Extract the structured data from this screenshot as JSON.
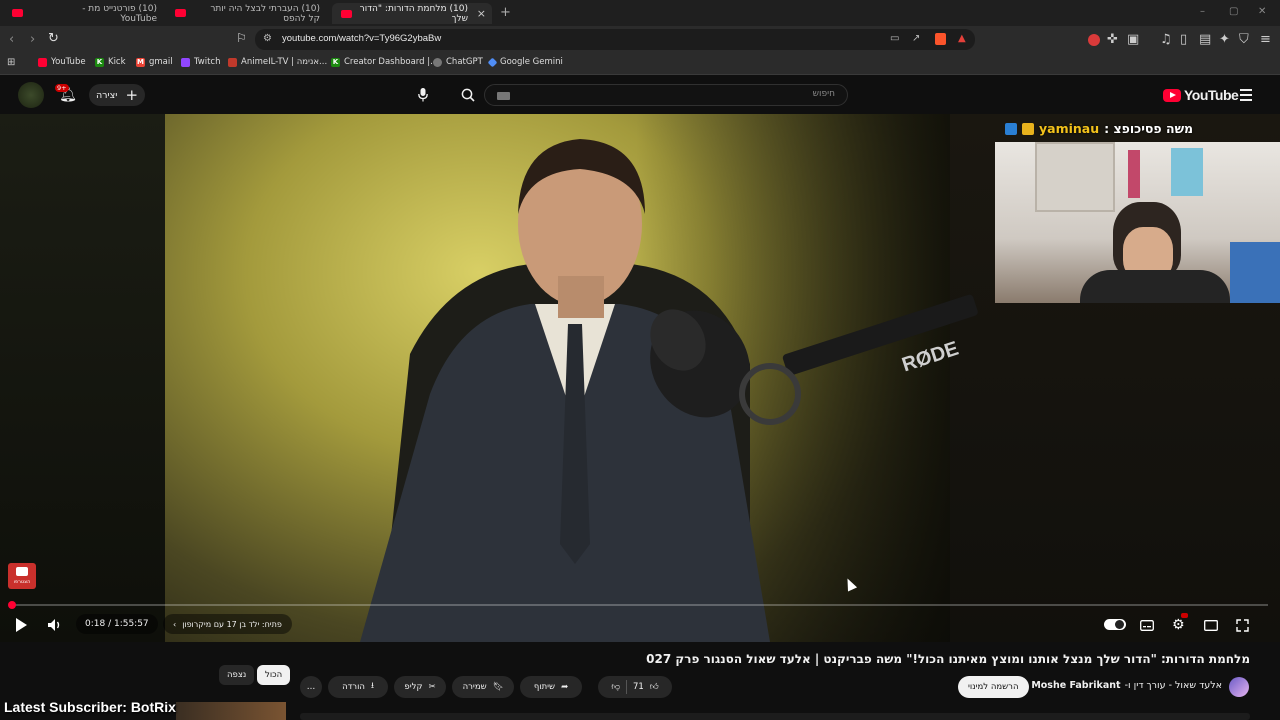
{
  "browser": {
    "tabs": [
      {
        "label": "(10) פורטנייט מת - YouTube",
        "active": false
      },
      {
        "label": "(10) העברתי לבצל היה יותר קל להפס",
        "active": false
      },
      {
        "label": "(10) מלחמת הדורות: \"הדור שלך",
        "active": true
      }
    ],
    "url": "youtube.com/watch?v=Ty96G2ybaBw",
    "bookmarks": [
      {
        "label": "YouTube",
        "icon": "youtube-icon",
        "color": "#ff0033"
      },
      {
        "label": "Kick",
        "icon": "kick-icon",
        "color": "#53fc18"
      },
      {
        "label": "gmail",
        "icon": "gmail-icon",
        "color": "#ea4335"
      },
      {
        "label": "Twitch",
        "icon": "twitch-icon",
        "color": "#9146ff"
      },
      {
        "label": "AnimeIL-TV | אנימה...",
        "icon": "animeil-icon",
        "color": "#c0392b"
      },
      {
        "label": "Creator Dashboard |...",
        "icon": "kick-icon",
        "color": "#53fc18"
      },
      {
        "label": "ChatGPT",
        "icon": "chatgpt-icon",
        "color": "#777777"
      },
      {
        "label": "Google Gemini",
        "icon": "gemini-icon",
        "color": "#4f8df5"
      }
    ]
  },
  "youtube": {
    "search_placeholder": "חיפוש",
    "create_label": "יצירה",
    "notifications_count": "9+",
    "logo_text": "YouTube",
    "accent": "#ff0033"
  },
  "player": {
    "overlay_prefix": "משה פסיכופצ :",
    "overlay_name": "yaminau",
    "time": "0:18 / 1:55:57",
    "chapter": "פתיח: ילד בן 17 עם מיקרופון",
    "progress_fraction": 0.0026,
    "subscribe_badge": "הצטרפו",
    "mic_brand": "RØDE"
  },
  "video": {
    "title": "מלחמת הדורות: \"הדור שלך מנצל אותנו ומוצץ מאיתנו הכול!\" משה פבריקנט | אלעד שאול הסנגור פרק 027",
    "channel_prefix": "אלעד שאול - עורך דין ו-",
    "channel_name": "Moshe Fabrikant",
    "subscribe_label": "הרשמה למינוי",
    "likes": "71",
    "share_label": "שיתוף",
    "save_label": "שמירה",
    "clip_label": "קליפ",
    "download_label": "הורדה",
    "more_label": "…"
  },
  "chips": {
    "all": "הכול",
    "watched": "נצפה"
  },
  "overlay": {
    "latest_subscriber": "Latest Subscriber: BotRix"
  }
}
